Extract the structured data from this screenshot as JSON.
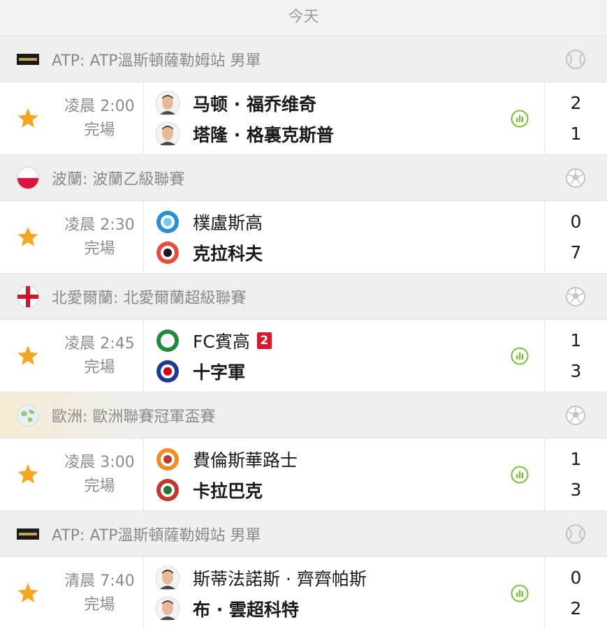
{
  "day_label": "今天",
  "colors": {
    "star": "#f5a623",
    "stats": "#7cbf3a",
    "red_card": "#d81b2c"
  },
  "groups": [
    {
      "league": "ATP: ATP溫斯頓薩勒姆站 男單",
      "flag_icon": "atp-flag-icon",
      "sport_icon": "tennis-ball-icon",
      "match": {
        "time": "凌晨 2:00",
        "status": "完場",
        "home": {
          "name": "马顿 · 福乔维奇",
          "logo": "player-avatar-icon",
          "red_cards": ""
        },
        "away": {
          "name": "塔隆 · 格裏克斯普",
          "logo": "player-avatar-icon"
        },
        "home_score": "2",
        "away_score": "1",
        "has_stats": true,
        "home_bold": true,
        "away_bold": true
      }
    },
    {
      "league": "波蘭: 波蘭乙級聯賽",
      "flag_icon": "poland-flag-icon",
      "sport_icon": "soccer-ball-icon",
      "match": {
        "time": "凌晨 2:30",
        "status": "完場",
        "home": {
          "name": "樸盧斯高",
          "logo": "club-crest-icon",
          "red_cards": ""
        },
        "away": {
          "name": "克拉科夫",
          "logo": "club-crest-icon"
        },
        "home_score": "0",
        "away_score": "7",
        "has_stats": false,
        "home_bold": false,
        "away_bold": true
      }
    },
    {
      "league": "北愛爾蘭: 北愛爾蘭超級聯賽",
      "flag_icon": "northern-ireland-flag-icon",
      "sport_icon": "soccer-ball-icon",
      "match": {
        "time": "凌晨 2:45",
        "status": "完場",
        "home": {
          "name": "FC賓高",
          "logo": "club-crest-icon",
          "red_cards": "2"
        },
        "away": {
          "name": "十字軍",
          "logo": "club-crest-icon"
        },
        "home_score": "1",
        "away_score": "3",
        "has_stats": true,
        "home_bold": false,
        "away_bold": true
      }
    },
    {
      "league": "歐洲: 歐洲聯賽冠軍盃賽",
      "flag_icon": "globe-icon",
      "sport_icon": "soccer-ball-icon",
      "match": {
        "time": "凌晨 3:00",
        "status": "完場",
        "home": {
          "name": "費倫斯華路士",
          "logo": "club-crest-icon",
          "red_cards": ""
        },
        "away": {
          "name": "卡拉巴克",
          "logo": "club-crest-icon"
        },
        "home_score": "1",
        "away_score": "3",
        "has_stats": true,
        "home_bold": false,
        "away_bold": true
      }
    },
    {
      "league": "ATP: ATP溫斯頓薩勒姆站 男單",
      "flag_icon": "atp-flag-icon",
      "sport_icon": "tennis-ball-icon",
      "match": {
        "time": "清晨 7:40",
        "status": "完場",
        "home": {
          "name": "斯蒂法諾斯 · 齊齊帕斯",
          "logo": "player-avatar-icon",
          "red_cards": ""
        },
        "away": {
          "name": "布 · 雲超科特",
          "logo": "player-avatar-icon"
        },
        "home_score": "0",
        "away_score": "2",
        "has_stats": true,
        "home_bold": false,
        "away_bold": true
      }
    }
  ]
}
